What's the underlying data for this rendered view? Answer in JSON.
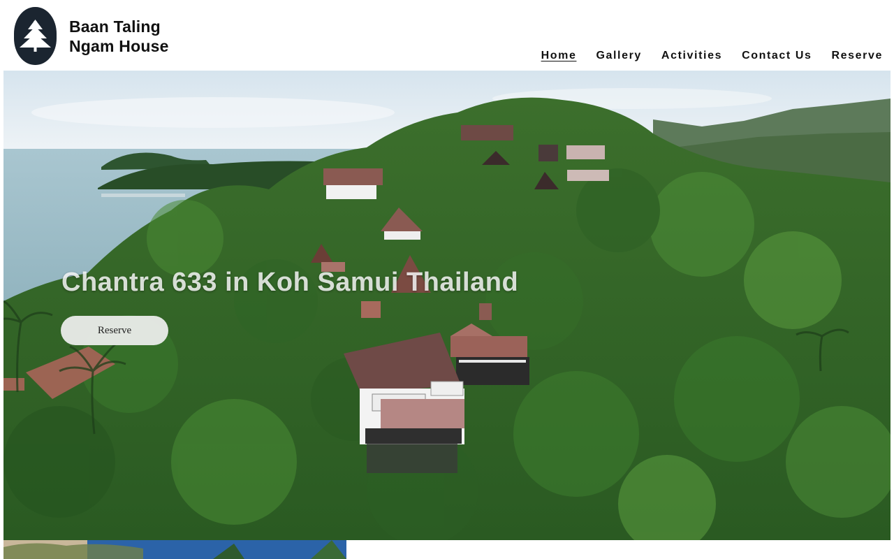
{
  "brand": {
    "name_line1": "Baan Taling",
    "name_line2": "Ngam House",
    "logo_icon": "pine-tree-icon",
    "logo_color": "#1b2530"
  },
  "nav": {
    "items": [
      {
        "label": "Home",
        "active": true
      },
      {
        "label": "Gallery",
        "active": false
      },
      {
        "label": "Activities",
        "active": false
      },
      {
        "label": "Contact Us",
        "active": false
      },
      {
        "label": "Reserve",
        "active": false
      }
    ]
  },
  "hero": {
    "title": "Chantra 633 in Koh Samui Thailand",
    "button_label": "Reserve"
  },
  "colors": {
    "sky": "#dfe9f0",
    "sea": "#9bbcc8",
    "forest_dark": "#1f4a1f",
    "forest_mid": "#3f7a2e",
    "roof": "#7a4f4a"
  }
}
